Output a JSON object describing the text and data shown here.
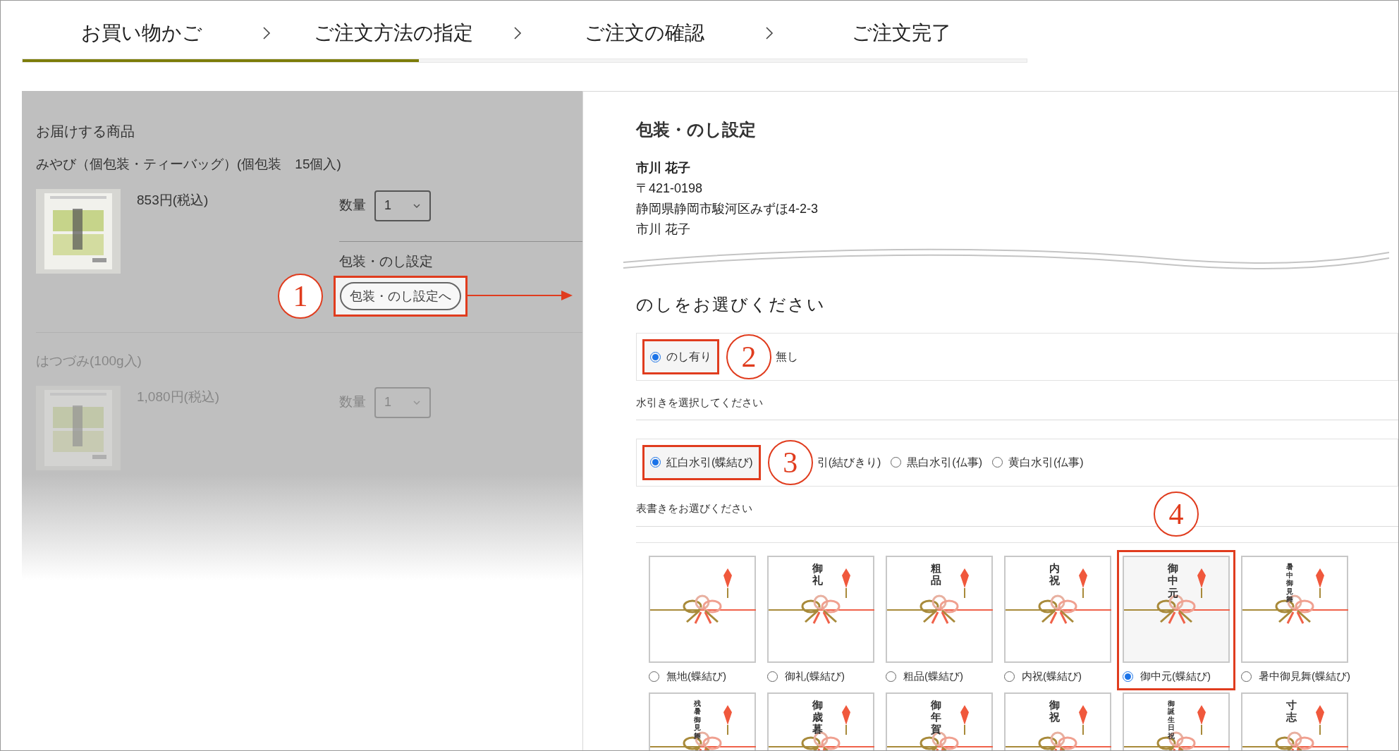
{
  "steps": [
    {
      "label": "お買い物かご"
    },
    {
      "label": "ご注文方法の指定"
    },
    {
      "label": "ご注文の確認"
    },
    {
      "label": "ご注文完了"
    }
  ],
  "progress": {
    "level": 0.395
  },
  "cart": {
    "title": "お届けする商品",
    "items": [
      {
        "name": "みやび（個包装・ティーバッグ）(個包装　15個入)",
        "price": "853円(税込)",
        "quantity_label": "数量",
        "quantity": "1",
        "wrapping_label": "包装・のし設定",
        "wrapping_button": "包装・のし設定へ",
        "callout": "1",
        "faded": false
      },
      {
        "name": "はつづみ(100g入)",
        "price": "1,080円(税込)",
        "quantity_label": "数量",
        "quantity": "1",
        "faded": true
      }
    ]
  },
  "modal": {
    "title": "包装・のし設定",
    "recipient": {
      "name": "市川 花子",
      "postal": "〒421-0198",
      "address": "静岡県静岡市駿河区みずほ4-2-3",
      "contact": "市川 花子"
    },
    "noshi_heading": "のしをお選びください",
    "noshi_options": [
      {
        "kind": "radio",
        "label": "のし有り",
        "selected": true,
        "callout": "2"
      },
      {
        "kind": "partial",
        "label": "無し"
      }
    ],
    "mizuhiki_label": "水引きを選択してください",
    "mizuhiki_options": [
      {
        "kind": "radio",
        "label": "紅白水引(蝶結び)",
        "selected": true,
        "callout": "3"
      },
      {
        "kind": "partial",
        "label": "引(結びきり)"
      },
      {
        "kind": "radio",
        "label": "黒白水引(仏事)",
        "selected": false
      },
      {
        "kind": "radio",
        "label": "黄白水引(仏事)",
        "selected": false
      }
    ],
    "omote_label": "表書きをお選びください",
    "cards": [
      {
        "label": "無地(蝶結び)",
        "selected": false
      },
      {
        "inscription": "御礼",
        "label": "御礼(蝶結び)",
        "selected": false
      },
      {
        "inscription": "粗品",
        "label": "粗品(蝶結び)",
        "selected": false
      },
      {
        "inscription": "内祝",
        "label": "内祝(蝶結び)",
        "selected": false
      },
      {
        "inscription": "御中元",
        "label": "御中元(蝶結び)",
        "selected": true,
        "callout": "4"
      },
      {
        "inscription": "暑中御見舞",
        "label": "暑中御見舞(蝶結び)",
        "selected": false
      },
      {
        "inscription": "残暑御見舞"
      },
      {
        "inscription": "御歳暮"
      },
      {
        "inscription": "御年賀"
      },
      {
        "inscription": "御祝"
      },
      {
        "inscription": "御誕生日祝"
      },
      {
        "inscription": "寸志"
      }
    ]
  }
}
